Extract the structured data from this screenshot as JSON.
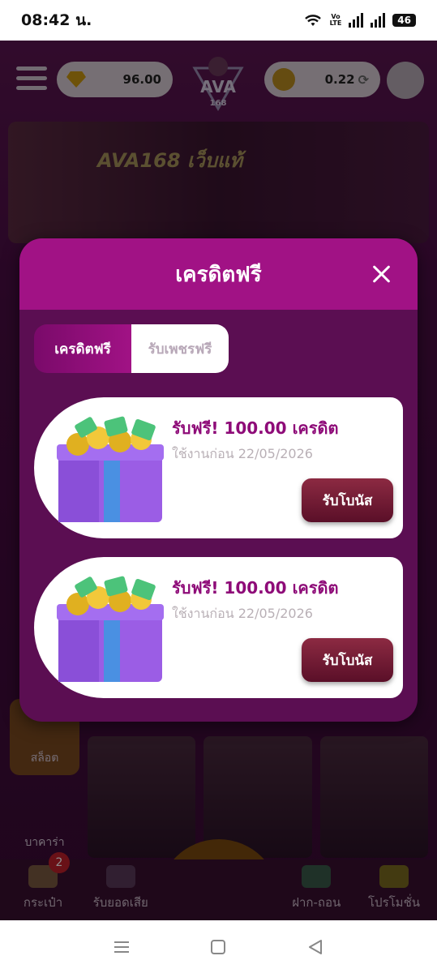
{
  "status_bar": {
    "time": "08:42 น.",
    "volte_top": "Vo",
    "volte_bottom": "LTE",
    "battery": "46"
  },
  "app": {
    "diamond_balance": "96.00",
    "coin_balance": "0.22",
    "logo_text": "AVA",
    "logo_sub": "168",
    "banner_text": "AVA168 เว็บแท้",
    "side_menu": [
      {
        "label": "สล็อต"
      },
      {
        "label": "บาคาร่า"
      }
    ],
    "bottom_nav": [
      {
        "label": "กระเป๋า",
        "badge": "2"
      },
      {
        "label": "รับยอดเสีย"
      },
      {
        "label": ""
      },
      {
        "label": "ฝาก-ถอน"
      },
      {
        "label": "โปรโมชั่น"
      }
    ]
  },
  "modal": {
    "title": "เครดิตฟรี",
    "tabs": [
      {
        "label": "เครดิตฟรี",
        "active": true
      },
      {
        "label": "รับเพชรฟรี",
        "active": false
      }
    ],
    "cards": [
      {
        "title": "รับฟรี! 100.00 เครดิต",
        "expiry": "ใช้งานก่อน 22/05/2026",
        "button": "รับโบนัส"
      },
      {
        "title": "รับฟรี! 100.00 เครดิต",
        "expiry": "ใช้งานก่อน 22/05/2026",
        "button": "รับโบนัส"
      }
    ]
  },
  "colors": {
    "modal_header": "#a11285",
    "modal_body": "#5b0e52",
    "card_title": "#8e0b78",
    "claim_button": "#6e1a35"
  },
  "icons": [
    "wifi-icon",
    "signal-icon",
    "menu-icon",
    "diamond-icon",
    "coin-icon",
    "refresh-icon",
    "support-icon",
    "close-icon",
    "gift-box-icon",
    "wallet-icon",
    "recents-icon",
    "home-icon",
    "back-icon"
  ]
}
